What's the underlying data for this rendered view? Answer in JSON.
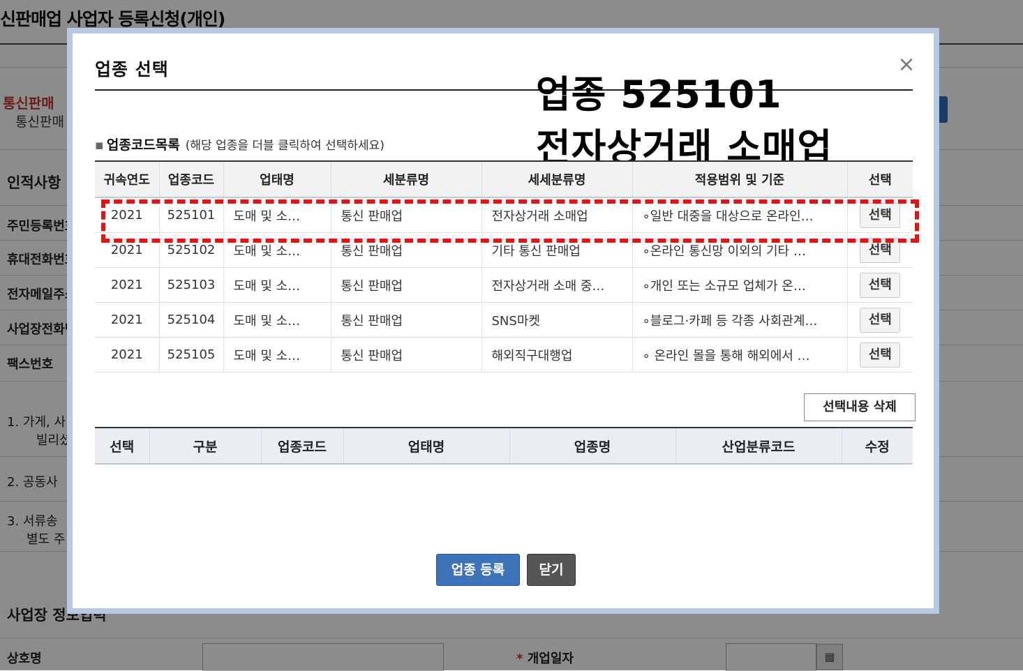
{
  "background": {
    "title": "신판매업 사업자 등록신청(개인)",
    "red_label": "통신판매",
    "red_sub": "통신판매",
    "section_personal": "인적사항",
    "labels": [
      "주민등록번호",
      "휴대전화번호",
      "전자메일주소",
      "사업장전화번호",
      "팩스번호"
    ],
    "notes": [
      "1. 가게, 사",
      "빌리셨",
      "2. 공동사",
      "3. 서류송",
      "별도 주"
    ],
    "section_business": "사업장 정보입력",
    "trade_name_label": "상호명",
    "open_date_label": "개업일자",
    "required_mark": "*"
  },
  "modal": {
    "title": "업종 선택",
    "close_icon": "×",
    "list_title": "업종코드목록",
    "list_hint": "(해당 업종을 더블 클릭하여 선택하세요)",
    "callout_line1": "업종 525101",
    "callout_line2": "전자상거래 소매업",
    "table_headers": [
      "귀속연도",
      "업종코드",
      "업태명",
      "세분류명",
      "세세분류명",
      "적용범위 및 기준",
      "선택"
    ],
    "rows": [
      {
        "year": "2021",
        "code": "525101",
        "biz_type": "도매 및 소…",
        "sub_class": "통신 판매업",
        "detail_class": "전자상거래 소매업",
        "scope": "∘일반 대중을 대상으로 온라인…",
        "action": "선택"
      },
      {
        "year": "2021",
        "code": "525102",
        "biz_type": "도매 및 소…",
        "sub_class": "통신 판매업",
        "detail_class": "기타 통신 판매업",
        "scope": "∘온라인 통신망 이외의 기타 …",
        "action": "선택"
      },
      {
        "year": "2021",
        "code": "525103",
        "biz_type": "도매 및 소…",
        "sub_class": "통신 판매업",
        "detail_class": "전자상거래 소매 중…",
        "scope": "∘개인 또는 소규모 업체가 온…",
        "action": "선택"
      },
      {
        "year": "2021",
        "code": "525104",
        "biz_type": "도매 및 소…",
        "sub_class": "통신 판매업",
        "detail_class": "SNS마켓",
        "scope": "∘블로그·카페 등 각종 사회관계…",
        "action": "선택"
      },
      {
        "year": "2021",
        "code": "525105",
        "biz_type": "도매 및 소…",
        "sub_class": "통신 판매업",
        "detail_class": "해외직구대행업",
        "scope": "∘ 온라인 몰을 통해 해외에서 …",
        "action": "선택"
      }
    ],
    "delete_button": "선택내용 삭제",
    "selected_headers": [
      "선택",
      "구분",
      "업종코드",
      "업태명",
      "업종명",
      "산업분류코드",
      "수정"
    ],
    "register_button": "업종 등록",
    "close_button": "닫기"
  },
  "colors": {
    "highlight": "#e41414",
    "primary_button": "#3d73b9",
    "dark_button": "#555555",
    "modal_border": "#b7c9e2"
  }
}
